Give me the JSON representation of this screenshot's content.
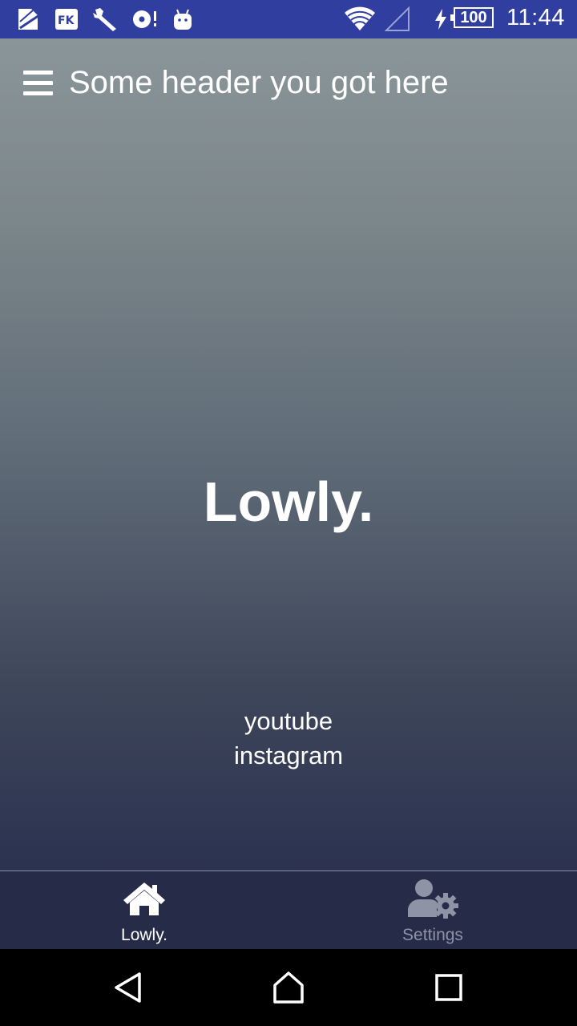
{
  "status_bar": {
    "battery": "100",
    "time": "11:44",
    "icons": [
      "document-icon",
      "fk-icon",
      "wrench-icon",
      "disc-icon",
      "android-icon",
      "wifi-icon",
      "cell-signal-icon",
      "charging-icon",
      "battery-icon"
    ]
  },
  "header": {
    "title": "Some header you got here",
    "menu_icon": "hamburger-menu-icon"
  },
  "main": {
    "brand": "Lowly.",
    "links": [
      "youtube",
      "instagram"
    ]
  },
  "tabs": [
    {
      "label": "Lowly.",
      "icon": "home-icon",
      "active": true
    },
    {
      "label": "Settings",
      "icon": "user-settings-icon",
      "active": false
    }
  ],
  "nav": {
    "icons": [
      "back-icon",
      "home-nav-icon",
      "recents-icon"
    ]
  },
  "colors": {
    "status_bar": "#303f9f",
    "gradient_top": "#8a9599",
    "gradient_bottom": "#2b3250",
    "tabbar": "#262c47",
    "tab_active": "#ffffff",
    "tab_inactive": "#8e93a6"
  }
}
